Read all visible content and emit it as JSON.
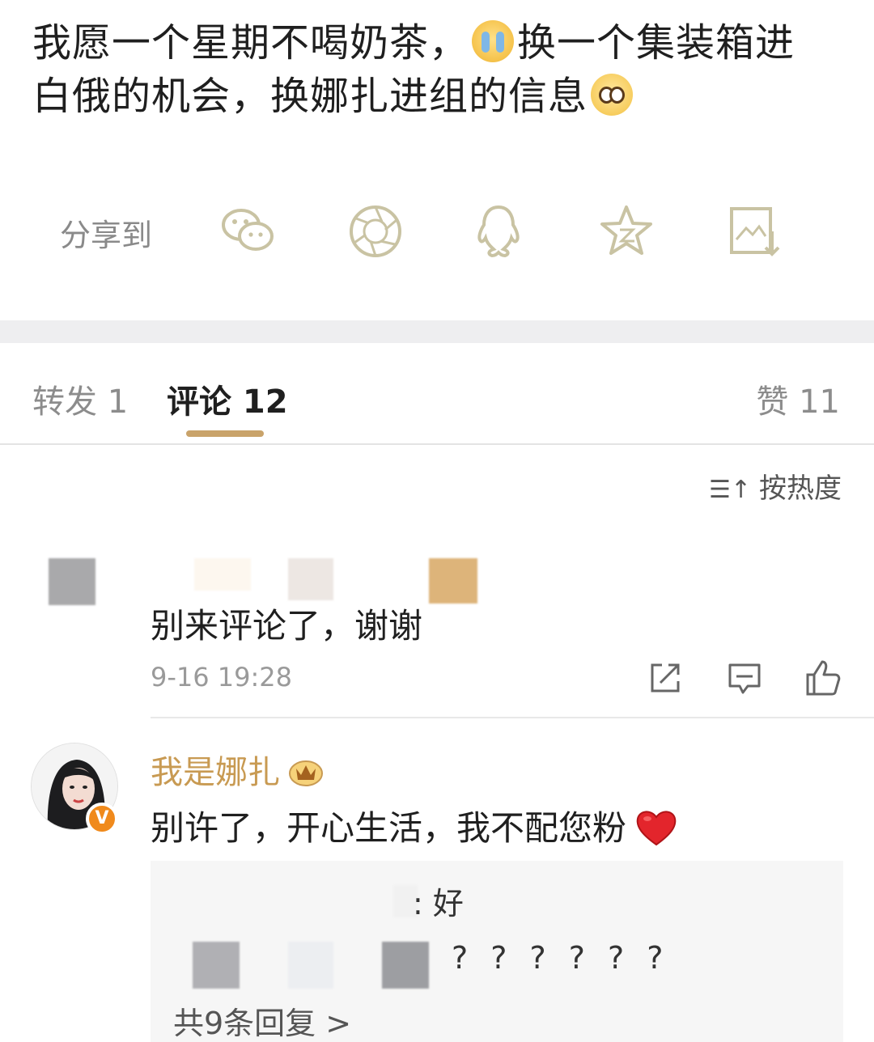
{
  "post": {
    "line1_a": "我愿一个星期不喝奶茶，",
    "line1_b": "换一个集装箱进",
    "line2": "白俄的机会，换娜扎进组的信息",
    "emoji1": "crying-face-icon",
    "emoji2": "pleading-face-icon"
  },
  "share": {
    "label": "分享到",
    "icons": [
      "wechat-icon",
      "moments-icon",
      "qq-icon",
      "qzone-icon",
      "save-image-icon"
    ],
    "icon_color": "#c9c3a3"
  },
  "tabs": {
    "repost": "转发 1",
    "comments": "评论 12",
    "likes": "赞 11",
    "indicator_color": "#c9a36a"
  },
  "sort": {
    "label": "按热度",
    "icon": "sort-icon"
  },
  "comment1": {
    "text": "别来评论了，谢谢",
    "time": "9-16 19:28",
    "actions": [
      "share-icon",
      "reply-icon",
      "like-icon"
    ]
  },
  "comment2": {
    "name": "我是娜扎",
    "name_color": "#c89a52",
    "badge": "V",
    "text": "别许了，开心生活，我不配您粉",
    "reply1": ": 好",
    "reply2": "? ? ? ? ? ?",
    "more": "共9条回复 >"
  }
}
